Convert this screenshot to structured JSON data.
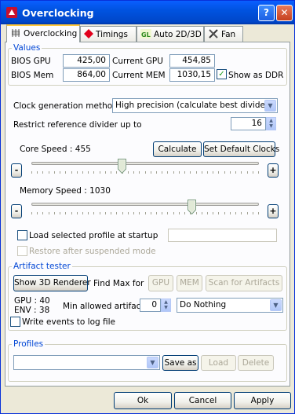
{
  "window": {
    "title": "Overclocking"
  },
  "tabs": [
    {
      "label": "Overclocking",
      "icon": "chip-icon"
    },
    {
      "label": "Timings",
      "icon": "red-diamond-icon"
    },
    {
      "label": "Auto 2D/3D",
      "icon": "gl-icon"
    },
    {
      "label": "Fan",
      "icon": "tools-icon"
    }
  ],
  "values": {
    "legend": "Values",
    "bios_gpu_label": "BIOS GPU",
    "bios_gpu": "425,00",
    "bios_mem_label": "BIOS Mem",
    "bios_mem": "864,00",
    "current_gpu_label": "Current GPU",
    "current_gpu": "454,85",
    "current_mem_label": "Current MEM",
    "current_mem": "1030,15",
    "show_ddr_label": "Show as DDR",
    "show_ddr_checked": true
  },
  "clock": {
    "method_label": "Clock generation method",
    "method_value": "High precision (calculate best divider)",
    "restrict_label": "Restrict reference divider up to",
    "restrict_value": "16",
    "core_label": "Core Speed : 455",
    "calculate_label": "Calculate",
    "default_label": "Set Default Clocks",
    "core_fraction": 0.395,
    "memory_label": "Memory Speed : 1030",
    "memory_fraction": 0.715,
    "minus": "-",
    "plus": "+",
    "load_profile_label": "Load selected profile at startup",
    "restore_label": "Restore after suspended mode"
  },
  "artifact": {
    "legend": "Artifact tester",
    "show3d_label": "Show 3D Renderer",
    "findmax_label": "Find Max for",
    "gpu_label": "GPU",
    "mem_label": "MEM",
    "scan_label": "Scan for Artifacts",
    "gpu_stat": "GPU : 40",
    "env_stat": "ENV : 38",
    "min_label": "Min allowed artifacts",
    "min_value": "0",
    "action_value": "Do Nothing",
    "write_log_label": "Write events to log file"
  },
  "profiles": {
    "legend": "Profiles",
    "select_value": "",
    "save_as_label": "Save as",
    "load_label": "Load",
    "delete_label": "Delete"
  },
  "footer": {
    "ok_label": "Ok",
    "cancel_label": "Cancel",
    "apply_label": "Apply"
  }
}
